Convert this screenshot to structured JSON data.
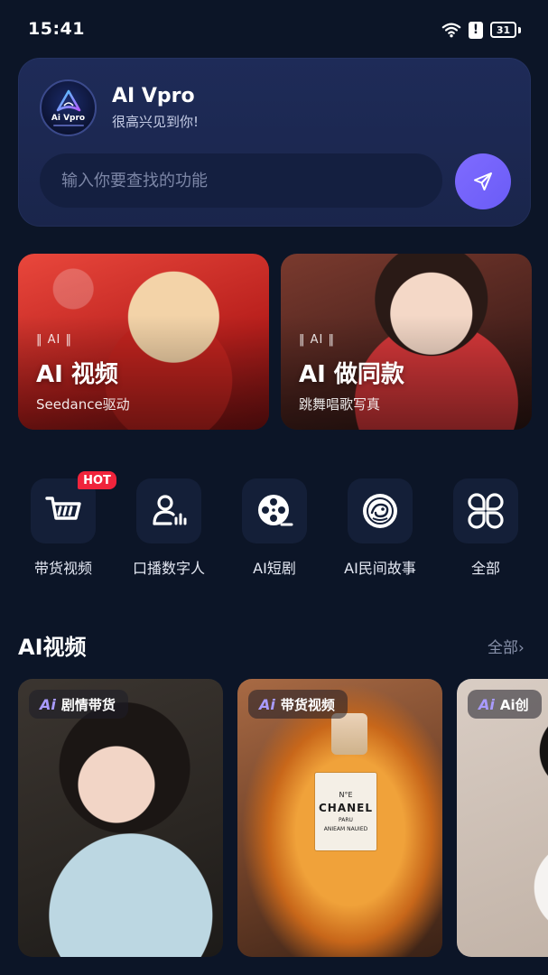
{
  "status_bar": {
    "time": "15:41",
    "battery": "31"
  },
  "header": {
    "app_name": "AI Vpro",
    "greeting": "很高兴见到你!",
    "logo_text": "Ai Vpro",
    "search_placeholder": "输入你要查找的功能",
    "accent_color": "#7b68fb"
  },
  "feature_cards": [
    {
      "tag": "‖ AI ‖",
      "title": "AI 视频",
      "subtitle": "Seedance驱动"
    },
    {
      "tag": "‖ AI ‖",
      "title": "AI 做同款",
      "subtitle": "跳舞唱歌写真"
    }
  ],
  "tools": [
    {
      "label": "带货视频",
      "icon": "shopping-cart-icon",
      "badge": "HOT"
    },
    {
      "label": "口播数字人",
      "icon": "digital-human-icon"
    },
    {
      "label": "AI短剧",
      "icon": "film-reel-icon"
    },
    {
      "label": "AI民间故事",
      "icon": "folk-story-icon"
    },
    {
      "label": "全部",
      "icon": "all-apps-icon"
    }
  ],
  "section": {
    "title": "AI视频",
    "all_label": "全部›"
  },
  "video_cards": [
    {
      "ai": "Ai",
      "label": "剧情带货"
    },
    {
      "ai": "Ai",
      "label": "带货视频",
      "product_text": [
        "N°E",
        "CHANEL",
        "PARU",
        "ANIEAM NAUIED"
      ]
    },
    {
      "ai": "Ai",
      "label": "Ai创"
    }
  ]
}
